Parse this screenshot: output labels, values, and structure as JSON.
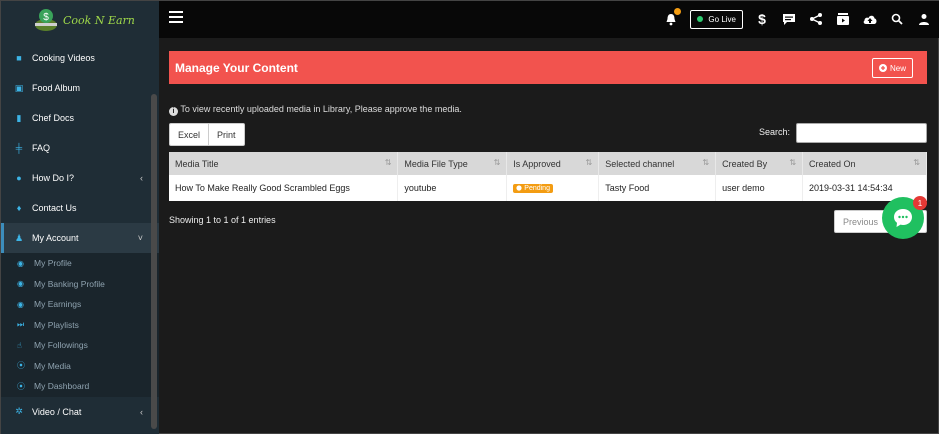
{
  "app": {
    "logo_text": "Cook N Earn"
  },
  "topbar": {
    "go_live_label": "Go Live",
    "icons": [
      "bell-icon",
      "dollar-icon",
      "message-icon",
      "share-icon",
      "video-icon",
      "upload-icon",
      "search-icon",
      "user-icon"
    ]
  },
  "sidebar": {
    "items": [
      {
        "label": "Cooking Videos",
        "icon": "video-camera-icon"
      },
      {
        "label": "Food Album",
        "icon": "image-icon"
      },
      {
        "label": "Chef Docs",
        "icon": "file-icon"
      },
      {
        "label": "FAQ",
        "icon": "faq-icon"
      },
      {
        "label": "How Do I?",
        "icon": "question-icon"
      },
      {
        "label": "Contact Us",
        "icon": "location-icon"
      },
      {
        "label": "My Account",
        "icon": "user-icon"
      }
    ],
    "account_sub": [
      {
        "label": "My Profile",
        "icon": "user-circle-icon"
      },
      {
        "label": "My Banking Profile",
        "icon": "user-circle-icon"
      },
      {
        "label": "My Earnings",
        "icon": "user-circle-icon"
      },
      {
        "label": "My Playlists",
        "icon": "playlist-icon"
      },
      {
        "label": "My Followings",
        "icon": "hand-icon"
      },
      {
        "label": "My Media",
        "icon": "play-circle-icon"
      },
      {
        "label": "My Dashboard",
        "icon": "play-circle-icon"
      }
    ],
    "video_chat": {
      "label": "Video / Chat",
      "icon": "gear-icon"
    }
  },
  "panel": {
    "title": "Manage Your Content",
    "new_label": "New"
  },
  "info_text": "To view recently uploaded media in Library, Please approve the media.",
  "buttons": {
    "excel": "Excel",
    "print": "Print"
  },
  "search": {
    "label": "Search:",
    "value": ""
  },
  "table": {
    "headers": [
      "Media Title",
      "Media File Type",
      "Is Approved",
      "Selected channel",
      "Created By",
      "Created On"
    ],
    "rows": [
      {
        "title": "How To Make Really Good Scrambled Eggs",
        "type": "youtube",
        "approved": "Pending",
        "channel": "Tasty Food",
        "created_by": "user demo",
        "created_on": "2019-03-31 14:54:34"
      }
    ]
  },
  "footer": {
    "showing": "Showing 1 to 1 of 1 entries",
    "prev": "Previous"
  },
  "chat": {
    "badge": "1"
  },
  "colors": {
    "accent": "#f2534e",
    "sidebar": "#1f2d36",
    "pending": "#f39c12",
    "chat": "#20c060"
  }
}
